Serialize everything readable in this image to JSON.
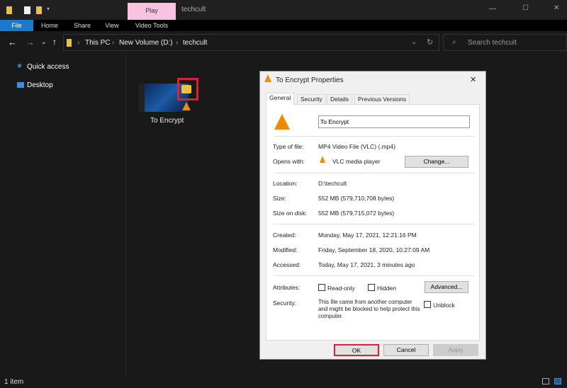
{
  "window": {
    "title": "techcult",
    "context_tab": "Play",
    "minimize": "—",
    "maximize": "☐",
    "close": "✕"
  },
  "ribbon": {
    "tabs": [
      "File",
      "Home",
      "Share",
      "View",
      "Video Tools"
    ]
  },
  "address": {
    "crumbs": [
      "This PC",
      "New Volume (D:)",
      "techcult"
    ],
    "search_placeholder": "Search techcult"
  },
  "sidebar": {
    "items": [
      "Quick access",
      "Desktop"
    ]
  },
  "file": {
    "name": "To Encrypt"
  },
  "status": {
    "count": "1 item"
  },
  "dialog": {
    "title": "To Encrypt Properties",
    "tabs": [
      "General",
      "Security",
      "Details",
      "Previous Versions"
    ],
    "name_value": "To Encrypt",
    "type_label": "Type of file:",
    "type_value": "MP4 Video File (VLC) (.mp4)",
    "opens_label": "Opens with:",
    "opens_value": "VLC media player",
    "change_button": "Change...",
    "location_label": "Location:",
    "location_value": "D:\\techcult",
    "size_label": "Size:",
    "size_value": "552 MB (579,710,708 bytes)",
    "disk_label": "Size on disk:",
    "disk_value": "552 MB (579,715,072 bytes)",
    "created_label": "Created:",
    "created_value": "Monday, May 17, 2021, 12:21:16 PM",
    "modified_label": "Modified:",
    "modified_value": "Friday, September 18, 2020, 10:27:09 AM",
    "accessed_label": "Accessed:",
    "accessed_value": "Today, May 17, 2021, 3 minutes ago",
    "attributes_label": "Attributes:",
    "readonly": "Read-only",
    "hidden": "Hidden",
    "advanced_button": "Advanced...",
    "security_label": "Security:",
    "security_text": "This file came from another computer and might be blocked to help protect this computer.",
    "unblock": "Unblock",
    "ok": "OK",
    "cancel": "Cancel",
    "apply": "Apply",
    "close": "✕"
  },
  "colors": {
    "highlight": "#e0202a",
    "accent": "#1979ca",
    "play_tab": "#f7c3e0"
  }
}
